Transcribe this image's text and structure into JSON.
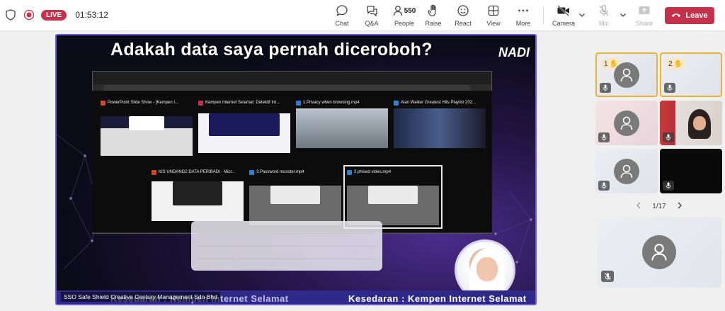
{
  "topbar": {
    "live_label": "LIVE",
    "timer": "01:53:12",
    "buttons": {
      "chat": "Chat",
      "qa": "Q&A",
      "people": "People",
      "people_count": "550",
      "raise": "Raise",
      "react": "React",
      "view": "View",
      "more": "More",
      "camera": "Camera",
      "mic": "Mic",
      "share": "Share"
    },
    "leave_label": "Leave"
  },
  "stage": {
    "slide_title": "Adakah data saya pernah diceroboh?",
    "logo_text": "NADI",
    "banner_left": "Kesedaran : Kempen Internet Selamat",
    "banner_right": "Kesedaran : Kempen Internet Selamat",
    "caption": "SSO Safe Shield Creative Century Management Sdn Bhd",
    "switcher_thumbs": [
      {
        "title": "PowerPoint Slide Show - [Kempen I...",
        "color": "#d24726"
      },
      {
        "title": "Kempen Internet Selamat: Detektif Int...",
        "color": "#c4314b"
      },
      {
        "title": "1.Privacy when browsing.mp4",
        "color": "#2d7dd2"
      },
      {
        "title": "Alan Walker Greatest Hits Playlist 202...",
        "color": "#2d7dd2"
      },
      {
        "title": "KIS UNDANG2 DATA PERIBADI - Micr...",
        "color": "#d24726"
      },
      {
        "title": "3.Password monster.mp4",
        "color": "#2d7dd2"
      },
      {
        "title": "2.phised video.mp4",
        "color": "#2d7dd2"
      }
    ]
  },
  "participants": {
    "tiles": [
      {
        "hand_number": "1",
        "kind": "avatar",
        "raised": true
      },
      {
        "hand_number": "2",
        "kind": "avatar",
        "raised": true
      },
      {
        "kind": "avatar"
      },
      {
        "kind": "video"
      },
      {
        "kind": "avatar"
      },
      {
        "kind": "black"
      }
    ],
    "pager": "1/17"
  },
  "colors": {
    "accent": "#6b5bd6",
    "live": "#c4314b",
    "leave": "#c4314b",
    "raised_hand": "#e8b232"
  }
}
